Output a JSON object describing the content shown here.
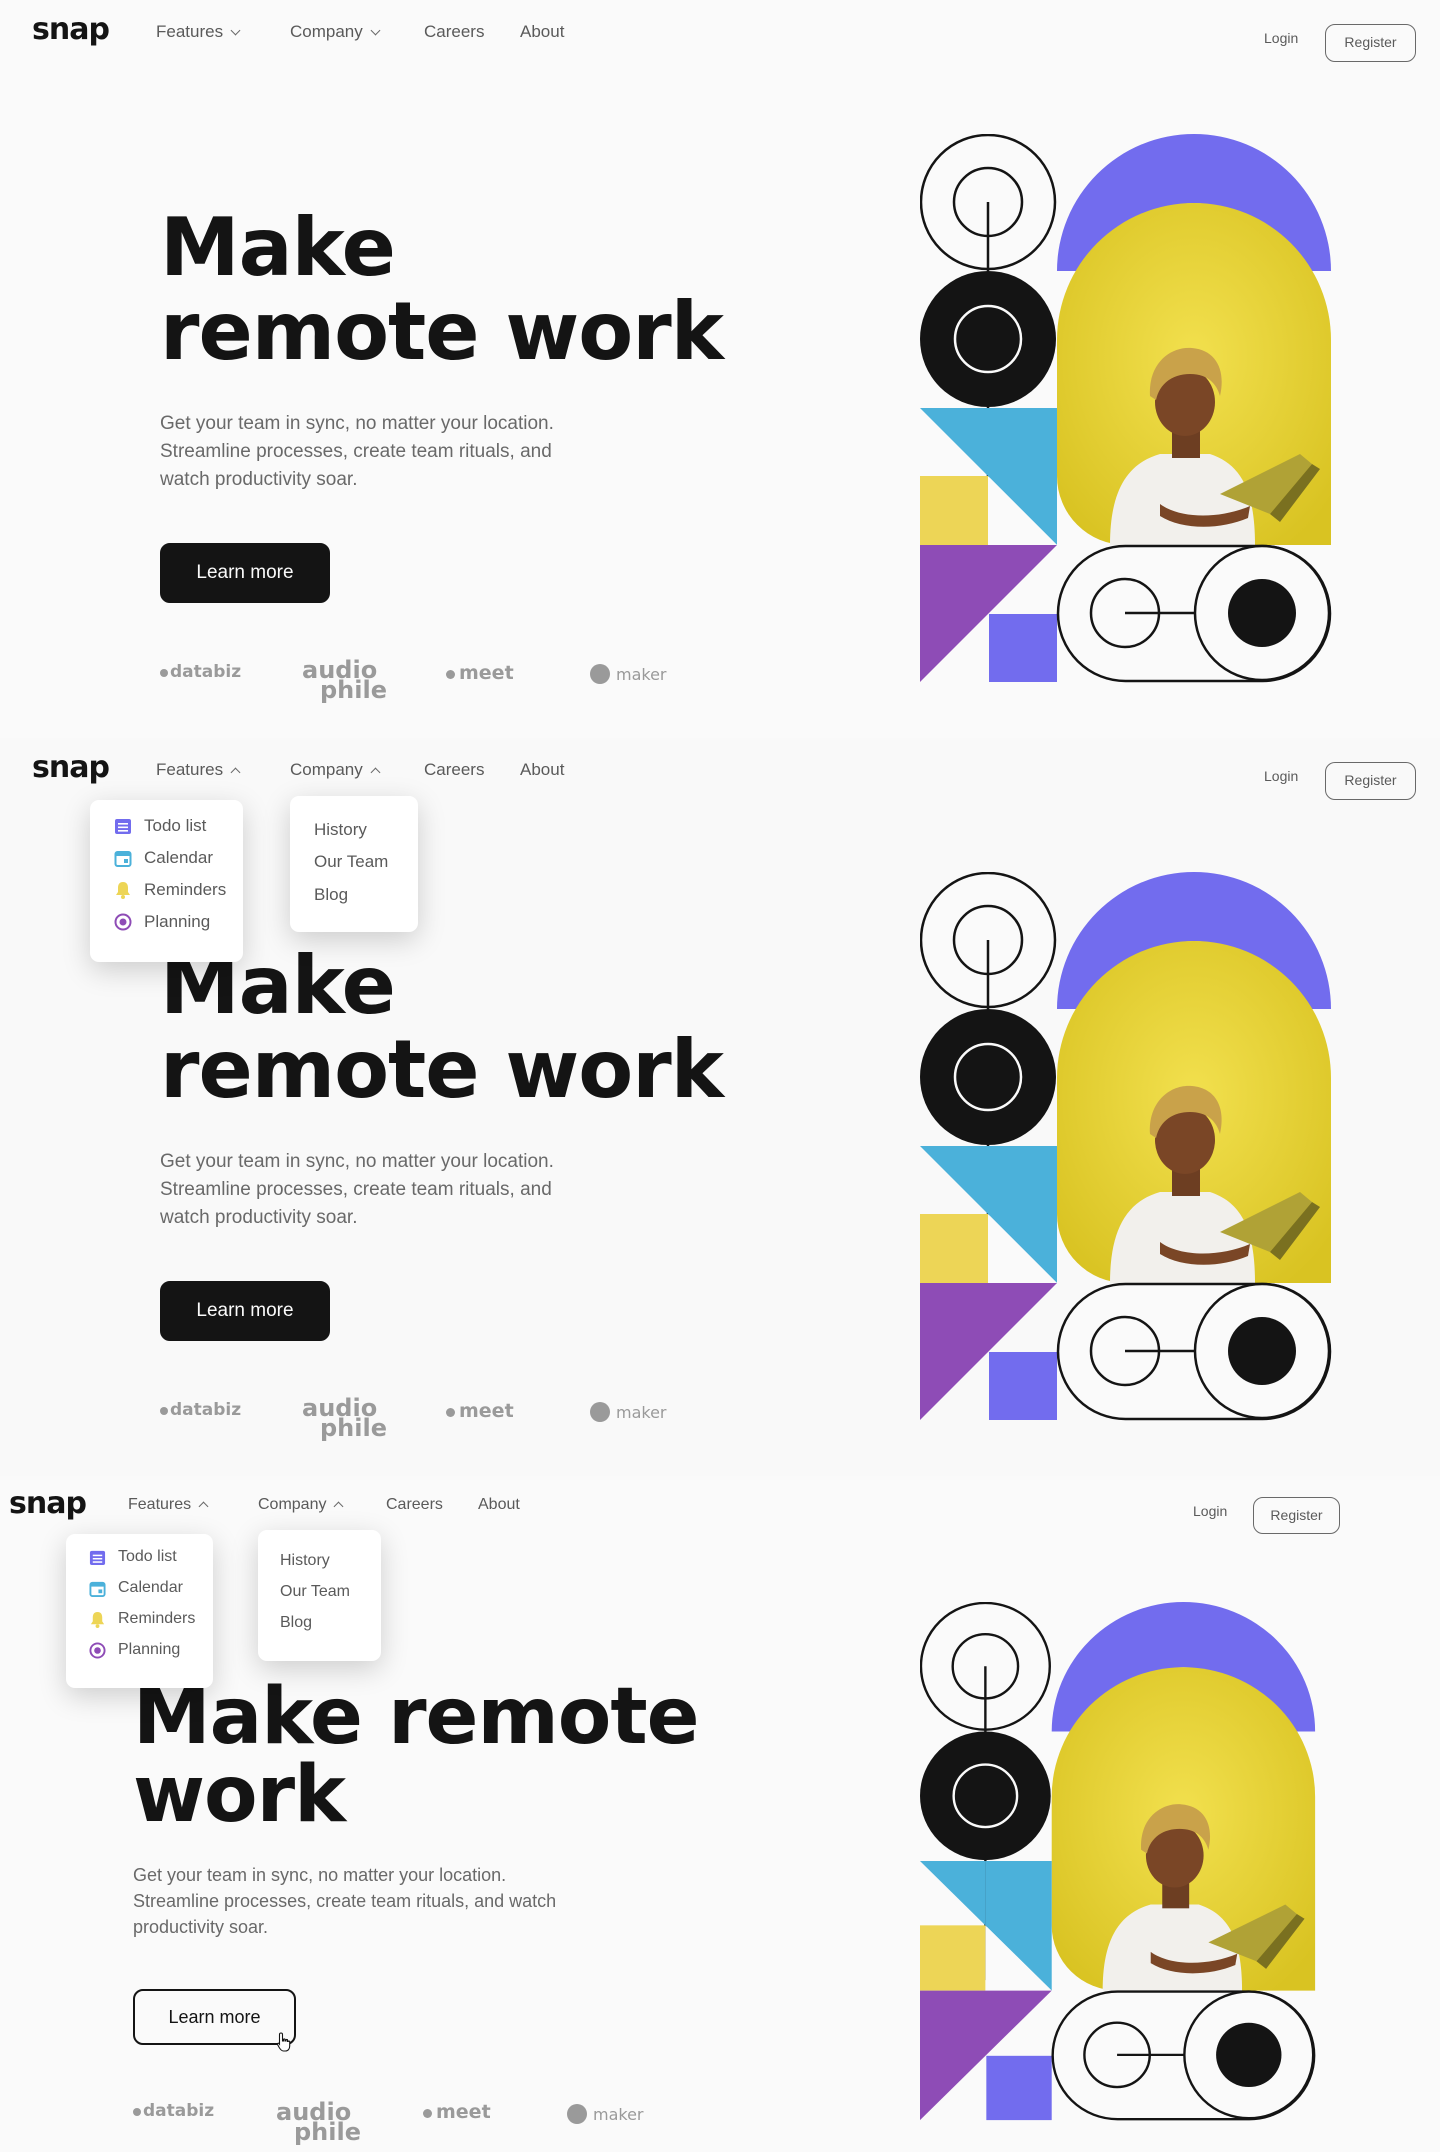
{
  "brand": {
    "logo": "snap"
  },
  "nav": {
    "features": "Features",
    "company": "Company",
    "careers": "Careers",
    "about": "About",
    "login": "Login",
    "register": "Register"
  },
  "features_menu": [
    {
      "label": "Todo list",
      "icon": "todo-icon",
      "color": "#726CEE"
    },
    {
      "label": "Calendar",
      "icon": "calendar-icon",
      "color": "#4BB1DA"
    },
    {
      "label": "Reminders",
      "icon": "bell-icon",
      "color": "#EDD556"
    },
    {
      "label": "Planning",
      "icon": "planning-icon",
      "color": "#8E4CB6"
    }
  ],
  "company_menu": [
    {
      "label": "History"
    },
    {
      "label": "Our Team"
    },
    {
      "label": "Blog"
    }
  ],
  "hero": {
    "title_line1": "Make",
    "title_line2": "remote work",
    "title_wide_line1": "Make remote",
    "title_wide_line2": "work",
    "description_lines": [
      "Get your team in sync, no matter your location.",
      "Streamline processes, create team rituals, and",
      "watch productivity soar."
    ],
    "description_wide_lines": [
      "Get your team in sync, no matter your location.",
      "Streamline processes, create team rituals, and watch",
      "productivity soar."
    ],
    "cta": "Learn more"
  },
  "clients": {
    "databiz": "databiz",
    "audiophile_top": "audio",
    "audiophile_bottom": "phile",
    "meet": "meet",
    "maker": "maker"
  },
  "colors": {
    "almost_white": "#FAFAFA",
    "almost_black": "#141414",
    "medium_gray": "#696969",
    "purple": "#726CEE",
    "blue": "#4BB1DA",
    "yellow": "#EDD556",
    "violet": "#8E4CB6"
  }
}
